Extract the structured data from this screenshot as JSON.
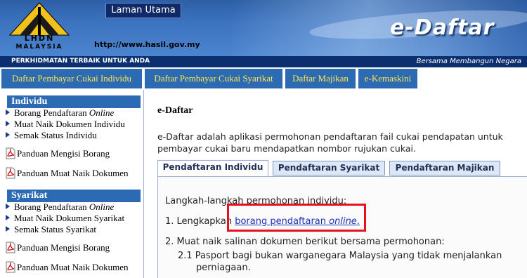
{
  "header": {
    "logo_text_1": "LHDN",
    "logo_text_2": "MALAYSIA",
    "home_button": "Laman Utama",
    "url": "http://www.hasil.gov.my",
    "brand_title": "e-Daftar",
    "slogan_left": "PERKHIDMATAN TERBAIK UNTUK ANDA",
    "slogan_right": "Bersama Membangun Negara"
  },
  "nav": {
    "items": [
      {
        "label": "Daftar Pembayar Cukai Individu"
      },
      {
        "label": "Daftar Pembayar Cukai Syarikat"
      },
      {
        "label": "Daftar Majikan"
      },
      {
        "label": "e-Kemaskini"
      }
    ]
  },
  "sidebar": {
    "individu": {
      "heading": "Individu",
      "items": [
        {
          "label": "Borang Pendaftaran",
          "label_em": "Online"
        },
        {
          "label": "Muat Naik Dokumen Individu"
        },
        {
          "label": "Semak Status Individu"
        },
        {
          "label": "Panduan Mengisi Borang"
        },
        {
          "label": "Panduan Muat Naik Dokumen"
        }
      ]
    },
    "syarikat": {
      "heading": "Syarikat",
      "items": [
        {
          "label": "Borang Pendaftaran",
          "label_em": "Online"
        },
        {
          "label": "Muat Naik Dokumen Syarikat"
        },
        {
          "label": "Semak Status Syarikat"
        },
        {
          "label": "Panduan Mengisi Borang"
        },
        {
          "label": "Panduan Muat Naik Dokumen"
        }
      ]
    }
  },
  "content": {
    "title": "e-Daftar",
    "intro_line1": "e-Daftar adalah aplikasi permohonan pendaftaran fail cukai pendapatan untuk",
    "intro_line2": "pembayar cukai baru mendapatkan nombor rujukan cukai.",
    "tabs": [
      {
        "label": "Pendaftaran Individu",
        "active": true
      },
      {
        "label": "Pendaftaran Syarikat",
        "active": false
      },
      {
        "label": "Pendaftaran Majikan",
        "active": false
      }
    ],
    "panel": {
      "heading": "Langkah-langkah permohonan individu:",
      "step1_prefix": "1. Lengkapkan",
      "step1_link": "borang pendaftaran",
      "step1_link_em": "online",
      "step1_suffix": ".",
      "step2": "2. Muat naik salinan dokumen berikut bersama permohonan:",
      "step2_1_line1": "2.1 Pasport bagi bukan warganegara Malaysia yang tidak menjalankan",
      "step2_1_line2": "perniagaan."
    }
  },
  "colors": {
    "header_blue": "#3c73bf",
    "nav_blue": "#2d6ab4",
    "nav_text": "#ffe84a",
    "highlight": "#e8101e",
    "link": "#1a2fb8"
  }
}
